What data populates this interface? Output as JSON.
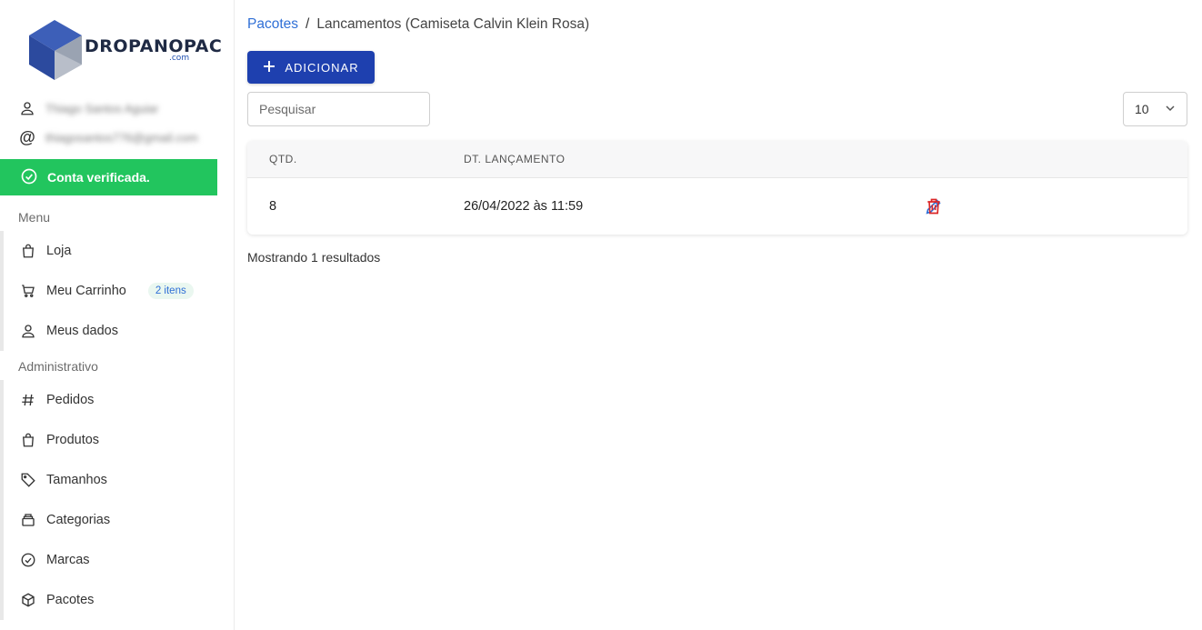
{
  "brand": {
    "logo_text": "DROPANOPAC",
    "logo_sub": ".com",
    "primary_color": "#1e40af",
    "success_color": "#22c55e",
    "danger_color": "#dc2626",
    "link_color": "#2f6fd6"
  },
  "user": {
    "name": "Thiago Santos Aguiar",
    "email": "thiagosantos776@gmail.com",
    "verified_label": "Conta verificada."
  },
  "sidebar": {
    "menu_title": "Menu",
    "menu_items": [
      {
        "label": "Loja",
        "icon": "shopping-bag-icon"
      },
      {
        "label": "Meu Carrinho",
        "icon": "cart-icon",
        "badge": "2 itens"
      },
      {
        "label": "Meus dados",
        "icon": "user-icon"
      }
    ],
    "admin_title": "Administrativo",
    "admin_items": [
      {
        "label": "Pedidos",
        "icon": "hash-icon"
      },
      {
        "label": "Produtos",
        "icon": "shopping-bag-icon"
      },
      {
        "label": "Tamanhos",
        "icon": "tag-icon"
      },
      {
        "label": "Categorias",
        "icon": "archive-icon"
      },
      {
        "label": "Marcas",
        "icon": "check-badge-icon"
      },
      {
        "label": "Pacotes",
        "icon": "box-icon"
      }
    ]
  },
  "main": {
    "breadcrumb": {
      "parent": "Pacotes",
      "separator": "/",
      "current": "Lancamentos (Camiseta Calvin Klein Rosa)"
    },
    "add_button_label": "ADICIONAR",
    "search_placeholder": "Pesquisar",
    "per_page_value": "10",
    "table": {
      "headers": [
        "QTD.",
        "DT. LANÇAMENTO"
      ],
      "rows": [
        {
          "qtd": "8",
          "date": "26/04/2022 às 11:59"
        }
      ]
    },
    "results_text": "Mostrando 1 resultados"
  }
}
